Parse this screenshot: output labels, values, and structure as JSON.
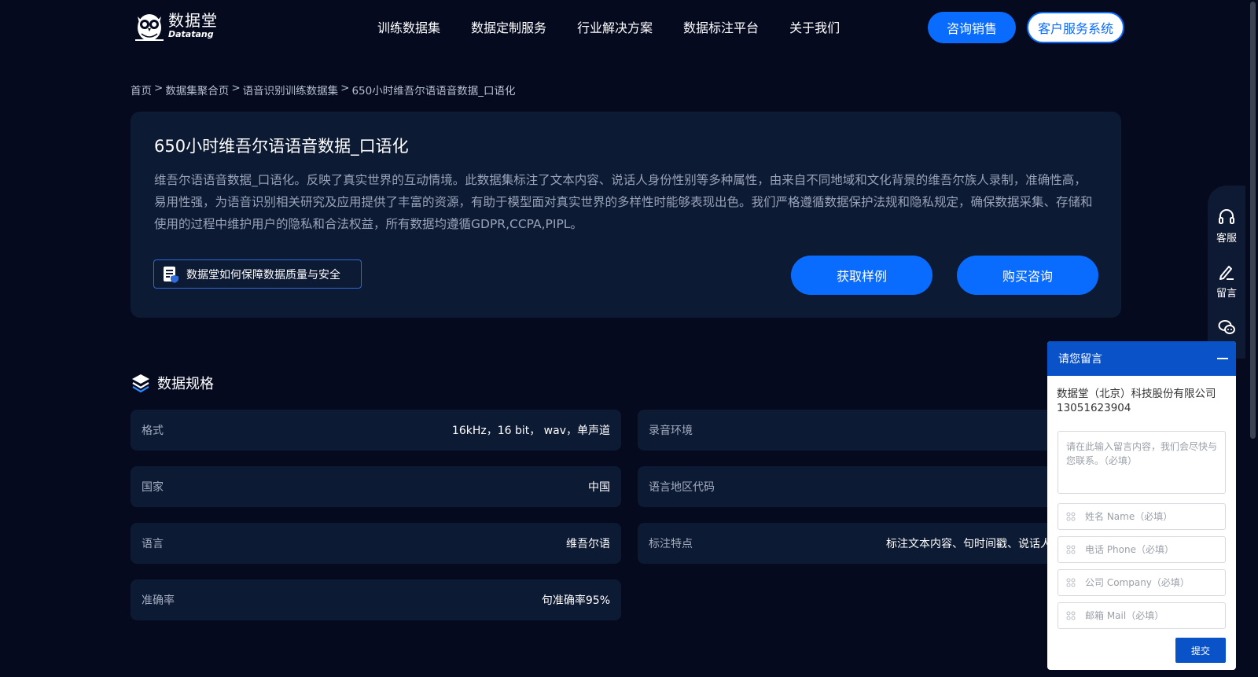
{
  "header": {
    "logo_cn": "数据堂",
    "logo_en": "Datatang",
    "nav": [
      "训练数据集",
      "数据定制服务",
      "行业解决方案",
      "数据标注平台",
      "关于我们"
    ],
    "consult_sales": "咨询销售",
    "customer_service": "客户服务系统"
  },
  "breadcrumb": {
    "items": [
      "首页",
      "数据集聚合页",
      "语音识别训练数据集",
      "650小时维吾尔语语音数据_口语化"
    ],
    "separator": ">"
  },
  "hero": {
    "title": "650小时维吾尔语语音数据_口语化",
    "description": "维吾尔语语音数据_口语化。反映了真实世界的互动情境。此数据集标注了文本内容、说话人身份性别等多种属性，由来自不同地域和文化背景的维吾尔族人录制，准确性高，易用性强，为语音识别相关研究及应用提供了丰富的资源，有助于模型面对真实世界的多样性时能够表现出色。我们严格遵循数据保护法规和隐私规定，确保数据采集、存储和使用的过程中维护用户的隐私和合法权益，所有数据均遵循GDPR,CCPA,PIPL。",
    "quality_link": "数据堂如何保障数据质量与安全",
    "get_sample": "获取样例",
    "buy_consult": "购买咨询"
  },
  "spec": {
    "heading": "数据规格",
    "left": [
      {
        "key": "格式",
        "value": "16kHz，16 bit， wav，单声道"
      },
      {
        "key": "国家",
        "value": "中国"
      },
      {
        "key": "语言",
        "value": "维吾尔语"
      },
      {
        "key": "准确率",
        "value": "句准确率95%"
      }
    ],
    "right": [
      {
        "key": "录音环境",
        "value": ""
      },
      {
        "key": "语言地区代码",
        "value": ""
      },
      {
        "key": "标注特点",
        "value": "标注文本内容、句时间戳、说话人"
      }
    ]
  },
  "toolbar": {
    "items": [
      "客服",
      "留言"
    ]
  },
  "message_panel": {
    "title": "请您留言",
    "company": "数据堂（北京）科技股份有限公司",
    "phone": "13051623904",
    "message_placeholder": "请在此输入留言内容，我们会尽快与您联系。（必填）",
    "name_placeholder": "姓名 Name（必填）",
    "phone_placeholder": "电话 Phone（必填）",
    "company_placeholder": "公司 Company（必填）",
    "mail_placeholder": "邮箱 Mail（必填）",
    "submit": "提交"
  },
  "colors": {
    "background": "#050a1f",
    "card": "#0d1a33",
    "accent": "#0a6cff",
    "panel_header": "#0a52c8"
  }
}
